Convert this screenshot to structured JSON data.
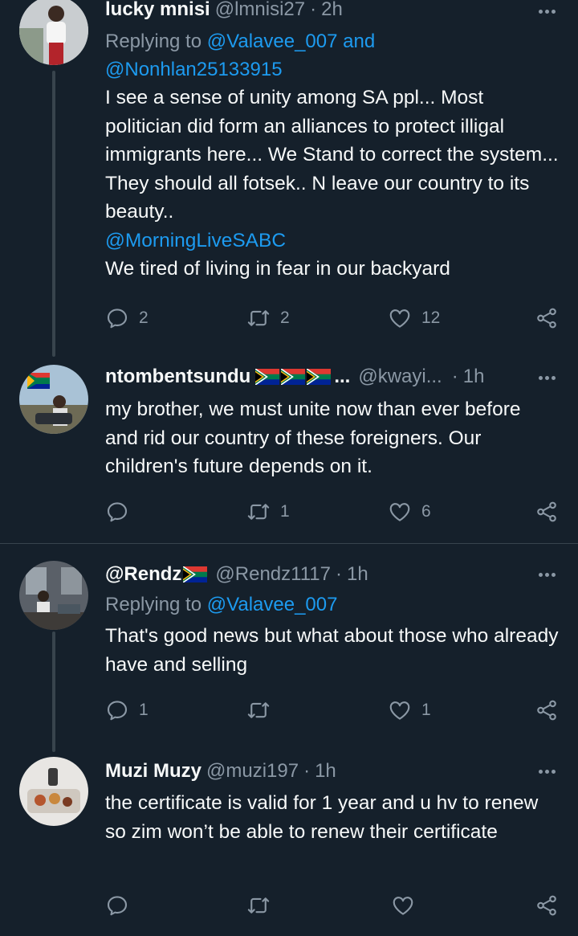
{
  "tweets": [
    {
      "name": "lucky mnisi",
      "handle": "@lmnisi27",
      "dot": "·",
      "time": "2h",
      "replying_prefix": "Replying to ",
      "replying_1": "@Valavee_007",
      "replying_and": " and",
      "replying_2": "@Nonhlan25133915",
      "text": "I see a sense of unity among SA ppl... Most politician did form an alliances to protect illigal immigrants here... We Stand to correct the system... They should all fotsek.. N leave our country to its beauty..",
      "mention": "@MorningLiveSABC",
      "text2": "We tired of living in fear in our backyard",
      "replies": "2",
      "retweets": "2",
      "likes": "12"
    },
    {
      "name": "ntombentsundu",
      "name_suffix": "...",
      "handle": "@kwayi...",
      "dot": "·",
      "time": "1h",
      "text": "my brother, we must unite now than ever before and rid our country of these foreigners. Our children's future depends on it.",
      "replies": "",
      "retweets": "1",
      "likes": "6"
    },
    {
      "name": "@Rendz",
      "handle": "@Rendz1117",
      "dot": "·",
      "time": "1h",
      "replying_prefix": "Replying to ",
      "replying_1": "@Valavee_007",
      "text": "That's good news but what about those who already have and selling",
      "replies": "1",
      "retweets": "",
      "likes": "1"
    },
    {
      "name": "Muzi Muzy",
      "handle": "@muzi197",
      "dot": "·",
      "time": "1h",
      "text": "the certificate is valid for 1 year and u hv to renew so zim won’t be able to renew their certificate",
      "replies": "",
      "retweets": "",
      "likes": ""
    }
  ],
  "icons": {
    "reply": "reply-icon",
    "retweet": "retweet-icon",
    "like": "heart-icon",
    "share": "share-icon",
    "more": "more-icon",
    "flag": "south-africa-flag-icon"
  },
  "colors": {
    "background": "#15202b",
    "text": "#f7f9f9",
    "secondary": "#8b98a5",
    "link": "#1d9bf0",
    "divider": "#38444d"
  }
}
